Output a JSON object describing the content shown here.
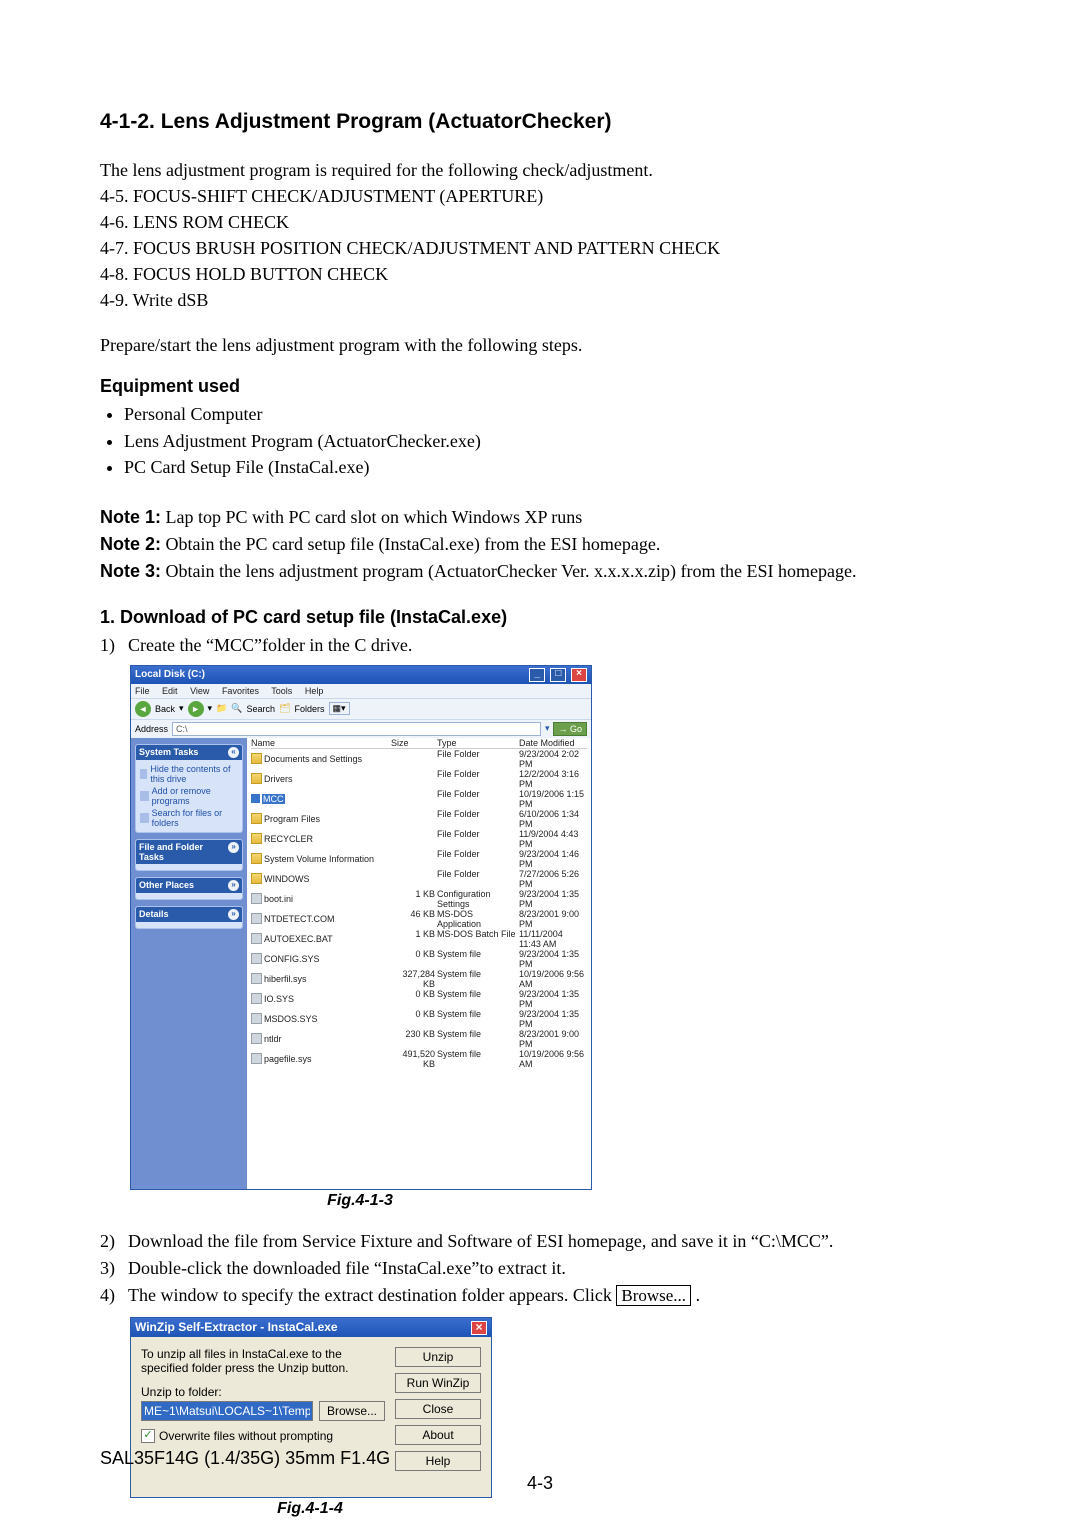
{
  "section_title": "4-1-2.  Lens Adjustment Program (ActuatorChecker)",
  "intro": "The lens adjustment program is required for the following check/adjustment.",
  "checks": [
    "4-5. FOCUS-SHIFT CHECK/ADJUSTMENT (APERTURE)",
    "4-6. LENS ROM CHECK",
    "4-7. FOCUS BRUSH POSITION CHECK/ADJUSTMENT AND PATTERN CHECK",
    "4-8. FOCUS HOLD BUTTON CHECK",
    "4-9. Write dSB"
  ],
  "instr": "Prepare/start the lens adjustment program with the following steps.",
  "equip_head": "Equipment used",
  "equip": [
    "Personal Computer",
    "Lens Adjustment Program (ActuatorChecker.exe)",
    "PC Card Setup File (InstaCal.exe)"
  ],
  "notes": [
    {
      "label": "Note 1:",
      "text": " Lap top PC with PC card slot on which Windows XP runs"
    },
    {
      "label": "Note 2:",
      "text": " Obtain the PC card setup file (InstaCal.exe) from the ESI homepage."
    },
    {
      "label": "Note 3:",
      "text": " Obtain the lens adjustment program (ActuatorChecker Ver. x.x.x.x.zip) from the ESI homepage."
    }
  ],
  "dl_head": "1.  Download of PC card setup file (InstaCal.exe)",
  "steps": {
    "s1": {
      "num": "1)",
      "text": "Create the “MCC”folder in the C drive."
    },
    "s2": {
      "num": "2)",
      "text": "Download the file from Service Fixture and Software of ESI homepage, and save it in “C:\\MCC”."
    },
    "s3": {
      "num": "3)",
      "text": "Double-click the downloaded file “InstaCal.exe”to extract it."
    },
    "s4": {
      "num": "4)",
      "text": "The window to specify the extract destination folder appears. Click "
    }
  },
  "browse_btn": "Browse...",
  "fig1": "Fig.4-1-3",
  "fig2": "Fig.4-1-4",
  "footer": {
    "model": "SAL35F14G (1.4/35G) 35mm F1.4G",
    "page": "4-3"
  },
  "explorer": {
    "title": "Local Disk (C:)",
    "menu": {
      "file": "File",
      "edit": "Edit",
      "view": "View",
      "fav": "Favorites",
      "tools": "Tools",
      "help": "Help"
    },
    "toolbar": {
      "back": "Back",
      "search": "Search",
      "folders": "Folders"
    },
    "addr": {
      "label": "Address",
      "path": "C:\\",
      "go": "Go"
    },
    "side": {
      "system": {
        "t": "System Tasks",
        "a": "Hide the contents of this drive",
        "b": "Add or remove programs",
        "c": "Search for files or folders"
      },
      "fft": "File and Folder Tasks",
      "other": "Other Places",
      "details": "Details"
    },
    "cols": {
      "name": "Name",
      "size": "Size",
      "type": "Type",
      "date": "Date Modified"
    },
    "rows": [
      {
        "n": "Documents and Settings",
        "s": "",
        "t": "File Folder",
        "d": "9/23/2004 2:02 PM",
        "k": "folder"
      },
      {
        "n": "Drivers",
        "s": "",
        "t": "File Folder",
        "d": "12/2/2004 3:16 PM",
        "k": "folder"
      },
      {
        "n": "MCC",
        "s": "",
        "t": "File Folder",
        "d": "10/19/2006 1:15 PM",
        "k": "sel"
      },
      {
        "n": "Program Files",
        "s": "",
        "t": "File Folder",
        "d": "6/10/2006 1:34 PM",
        "k": "folder"
      },
      {
        "n": "RECYCLER",
        "s": "",
        "t": "File Folder",
        "d": "11/9/2004 4:43 PM",
        "k": "folder"
      },
      {
        "n": "System Volume Information",
        "s": "",
        "t": "File Folder",
        "d": "9/23/2004 1:46 PM",
        "k": "folder"
      },
      {
        "n": "WINDOWS",
        "s": "",
        "t": "File Folder",
        "d": "7/27/2006 5:26 PM",
        "k": "folder"
      },
      {
        "n": "boot.ini",
        "s": "1 KB",
        "t": "Configuration Settings",
        "d": "9/23/2004 1:35 PM",
        "k": "file"
      },
      {
        "n": "NTDETECT.COM",
        "s": "46 KB",
        "t": "MS-DOS Application",
        "d": "8/23/2001 9:00 PM",
        "k": "file"
      },
      {
        "n": "AUTOEXEC.BAT",
        "s": "1 KB",
        "t": "MS-DOS Batch File",
        "d": "11/11/2004 11:43 AM",
        "k": "file"
      },
      {
        "n": "CONFIG.SYS",
        "s": "0 KB",
        "t": "System file",
        "d": "9/23/2004 1:35 PM",
        "k": "file"
      },
      {
        "n": "hiberfil.sys",
        "s": "327,284 KB",
        "t": "System file",
        "d": "10/19/2006 9:56 AM",
        "k": "file"
      },
      {
        "n": "IO.SYS",
        "s": "0 KB",
        "t": "System file",
        "d": "9/23/2004 1:35 PM",
        "k": "file"
      },
      {
        "n": "MSDOS.SYS",
        "s": "0 KB",
        "t": "System file",
        "d": "9/23/2004 1:35 PM",
        "k": "file"
      },
      {
        "n": "ntldr",
        "s": "230 KB",
        "t": "System file",
        "d": "8/23/2001 9:00 PM",
        "k": "file"
      },
      {
        "n": "pagefile.sys",
        "s": "491,520 KB",
        "t": "System file",
        "d": "10/19/2006 9:56 AM",
        "k": "file"
      }
    ]
  },
  "winzip": {
    "title": "WinZip Self-Extractor - InstaCal.exe",
    "msg": "To unzip all files in InstaCal.exe to the specified folder press the Unzip button.",
    "lbl": "Unzip to folder:",
    "path": "ME~1\\Matsui\\LOCALS~1\\Temp",
    "browse": "Browse...",
    "chk": "Overwrite files without prompting",
    "btn": {
      "unzip": "Unzip",
      "run": "Run WinZip",
      "close": "Close",
      "about": "About",
      "help": "Help"
    }
  }
}
